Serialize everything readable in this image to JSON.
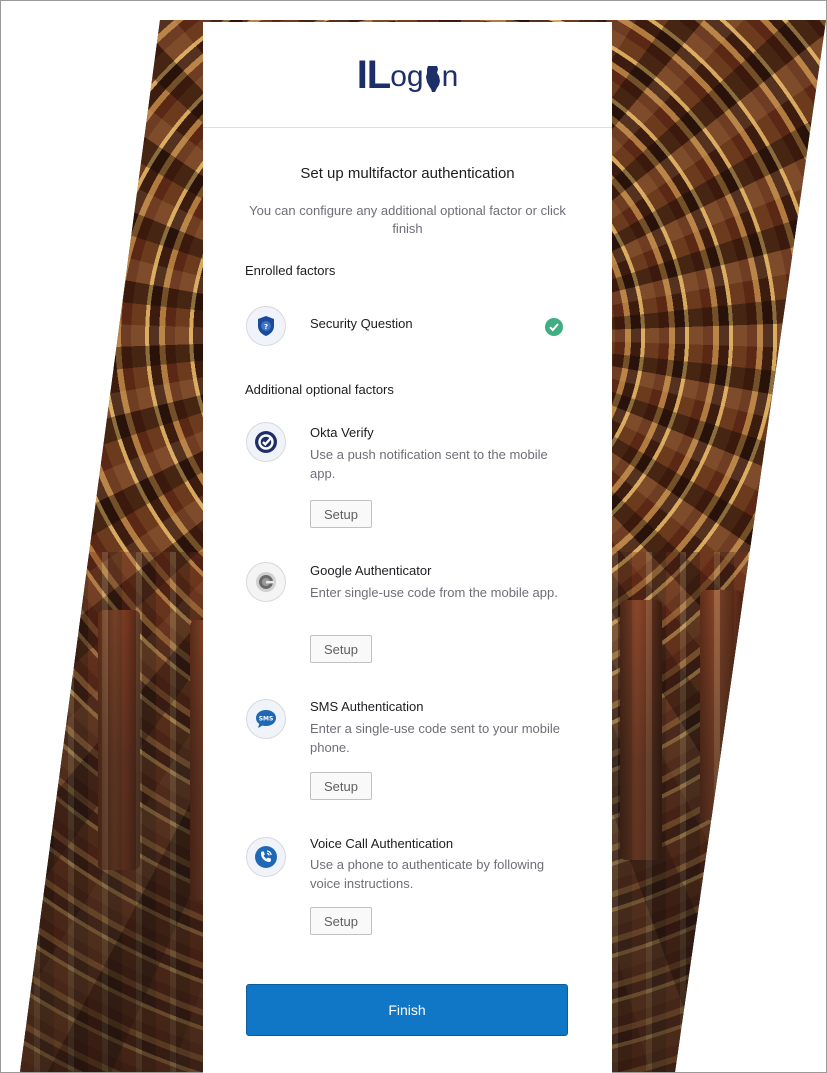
{
  "logo": {
    "part1": "IL",
    "part2": "og",
    "part3": "n"
  },
  "header": {
    "title": "Set up multifactor authentication",
    "subtitle": "You can configure any additional optional factor or click finish"
  },
  "enrolled": {
    "label": "Enrolled factors",
    "items": [
      {
        "title": "Security Question",
        "icon": "shield-question-icon",
        "status": "enrolled"
      }
    ]
  },
  "optional": {
    "label": "Additional optional factors",
    "items": [
      {
        "title": "Okta Verify",
        "description": "Use a push notification sent to the mobile app.",
        "button": "Setup",
        "icon": "okta-verify-icon"
      },
      {
        "title": "Google Authenticator",
        "description": "Enter single-use code from the mobile app.",
        "button": "Setup",
        "icon": "google-authenticator-icon"
      },
      {
        "title": "SMS Authentication",
        "description": "Enter a single-use code sent to your mobile phone.",
        "button": "Setup",
        "icon": "sms-icon"
      },
      {
        "title": "Voice Call Authentication",
        "description": "Use a phone to authenticate by following voice instructions.",
        "button": "Setup",
        "icon": "phone-call-icon"
      }
    ]
  },
  "finish_label": "Finish",
  "colors": {
    "primary": "#1077c6",
    "success": "#3faf83",
    "logo": "#1d2f6b"
  }
}
